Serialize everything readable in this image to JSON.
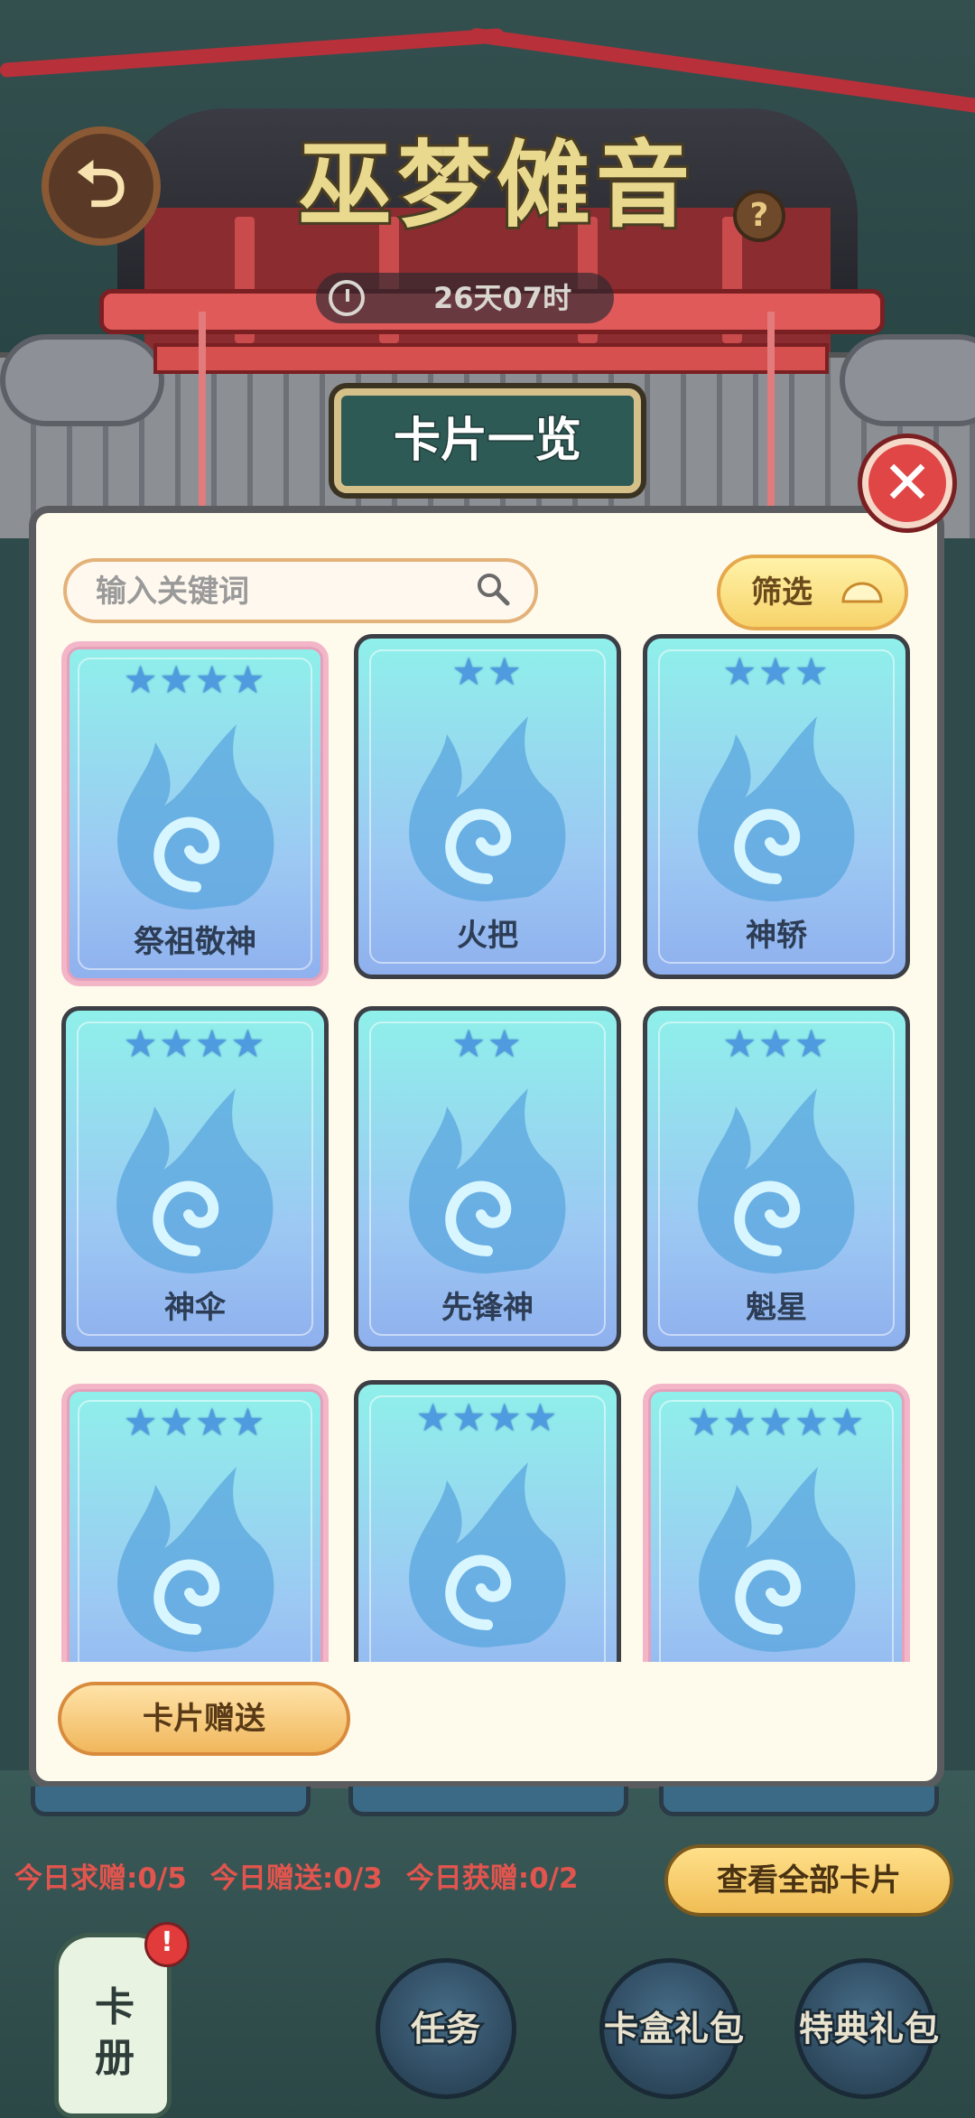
{
  "header": {
    "title": "巫梦傩音",
    "countdown": "26天07时",
    "help_icon_glyph": "?",
    "back_icon": "back-arrow-icon"
  },
  "panel": {
    "title": "卡片一览",
    "close_glyph": "✕",
    "search": {
      "placeholder": "输入关键词",
      "value": ""
    },
    "filter_label": "筛选",
    "cards": [
      {
        "name": "祭祖敬神",
        "stars": "★★★★",
        "frame": "pink"
      },
      {
        "name": "火把",
        "stars": "★★",
        "frame": "normal"
      },
      {
        "name": "神轿",
        "stars": "★★★",
        "frame": "normal"
      },
      {
        "name": "神伞",
        "stars": "★★★★",
        "frame": "normal"
      },
      {
        "name": "先锋神",
        "stars": "★★",
        "frame": "normal"
      },
      {
        "name": "魁星",
        "stars": "★★★",
        "frame": "normal"
      },
      {
        "name": "",
        "stars": "★★★★",
        "frame": "pink"
      },
      {
        "name": "",
        "stars": "★★★★",
        "frame": "normal"
      },
      {
        "name": "",
        "stars": "★★★★★",
        "frame": "pink"
      }
    ],
    "gift_button": "卡片赠送"
  },
  "stats": {
    "request": "今日求赠:0/5",
    "gifted": "今日赠送:0/3",
    "received": "今日获赠:0/2"
  },
  "view_all_button": "查看全部卡片",
  "lantern": {
    "label": "卡册",
    "badge": "!"
  },
  "bottom_buttons": [
    "任务",
    "卡盒礼包",
    "特典礼包"
  ],
  "colors": {
    "accent_red": "#e2554e",
    "card_blue": "#9cc8f3",
    "star_blue": "#4e9be0",
    "panel_bg": "#fffbec"
  }
}
